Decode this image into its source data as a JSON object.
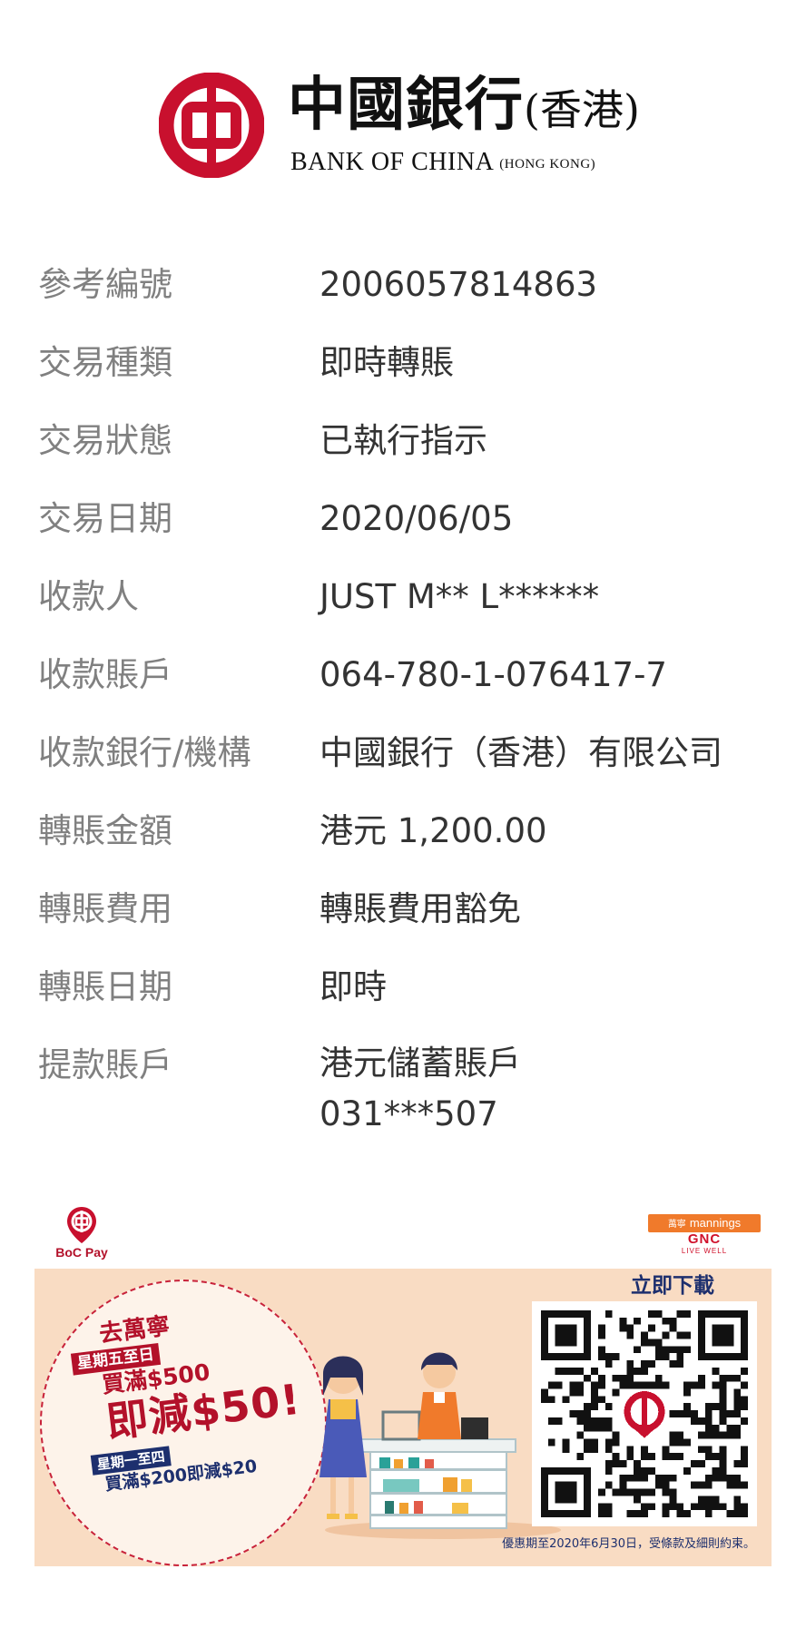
{
  "header": {
    "logo_cn": "中國銀行",
    "logo_cn_suffix": "(香港)",
    "logo_en": "BANK OF CHINA",
    "logo_en_suffix": "(HONG KONG)",
    "logo_icon": "boc-logo-icon",
    "brand_color": "#c8102e"
  },
  "details": [
    {
      "label": "參考編號",
      "value": "2006057814863"
    },
    {
      "label": "交易種類",
      "value": "即時轉賬"
    },
    {
      "label": "交易狀態",
      "value": "已執行指示"
    },
    {
      "label": "交易日期",
      "value": "2020/06/05"
    },
    {
      "label": "收款人",
      "value": "JUST M** L******"
    },
    {
      "label": "收款賬戶",
      "value": "064-780-1-076417-7"
    },
    {
      "label": "收款銀行/機構",
      "value": "中國銀行（香港）有限公司"
    },
    {
      "label": "轉賬金額",
      "value": "港元 1,200.00"
    },
    {
      "label": "轉賬費用",
      "value": "轉賬費用豁免"
    },
    {
      "label": "轉賬日期",
      "value": "即時"
    },
    {
      "label": "提款賬戶",
      "value": "港元儲蓄賬戶",
      "value2": "031***507"
    }
  ],
  "promo": {
    "bocpay_label": "BoC Pay",
    "partner_top_cn": "萬寧",
    "partner_top": "mannings",
    "partner_bottom": "GNC",
    "partner_sub": "LIVE WELL",
    "headline": "去萬寧",
    "tag1": "星期五至日",
    "line2": "買滿$500",
    "big": "即減$50!",
    "tag2": "星期一至四",
    "line3": "買滿$200即減$20",
    "qr_title": "立即下載",
    "note": "優惠期至2020年6月30日，受條款及細則約束。",
    "accent": "#b3112a",
    "navy": "#1d2f6e",
    "bg": "#f9dcc3"
  }
}
